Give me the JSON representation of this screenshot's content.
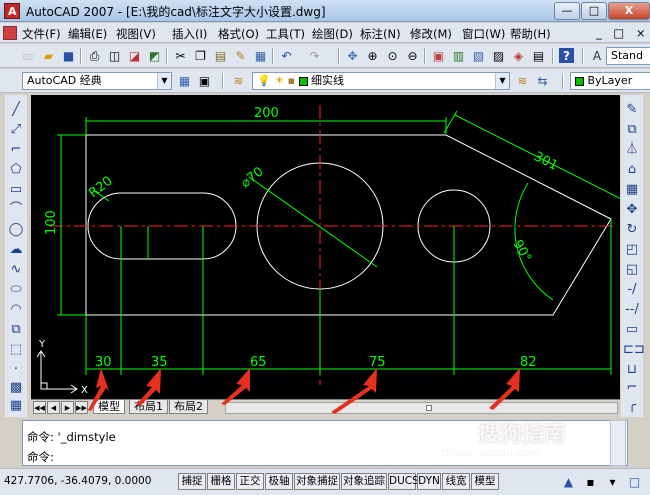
{
  "window": {
    "title": "AutoCAD 2007 - [E:\\我的cad\\标注文字大小设置.dwg]",
    "buttons": {
      "minimize": "—",
      "restore": "□",
      "close": "X"
    }
  },
  "menu": {
    "items": [
      "文件(F)",
      "编辑(E)",
      "视图(V)",
      "插入(I)",
      "格式(O)",
      "工具(T)",
      "绘图(D)",
      "标注(N)",
      "修改(M)",
      "窗口(W)",
      "帮助(H)"
    ],
    "doc_controls": "_ □ ×"
  },
  "toolbar": {
    "text_style": "Stand",
    "workspace": "AutoCAD 经典",
    "layer": "细实线",
    "color": "ByLayer",
    "layer_color": "#00c000"
  },
  "drawing": {
    "dims": {
      "d200": "200",
      "d301": "301",
      "r20": "R20",
      "dia70": "⌀70",
      "d100": "100",
      "a90": "90°",
      "d30": "30",
      "d35": "35",
      "d65": "65",
      "d75": "75",
      "d82": "82"
    },
    "ucs_x": "X",
    "ucs_y": "Y",
    "colors": {
      "geometry": "#ffffff",
      "center": "#ff2020",
      "dimension": "#00ff00",
      "arrow": "#e53020"
    }
  },
  "tabs": [
    "模型",
    "布局1",
    "布局2"
  ],
  "command": {
    "line1": "命令: '_dimstyle",
    "line2": "命令:"
  },
  "status": {
    "coords": "427.7706, -36.4079, 0.0000",
    "buttons": [
      "捕捉",
      "栅格",
      "正交",
      "极轴",
      "对象捕捉",
      "对象追踪",
      "DUCS",
      "DYN",
      "线宽",
      "模型"
    ]
  },
  "watermark": {
    "brand": "搜狗指南",
    "url": "zhinan.sogou.com"
  }
}
